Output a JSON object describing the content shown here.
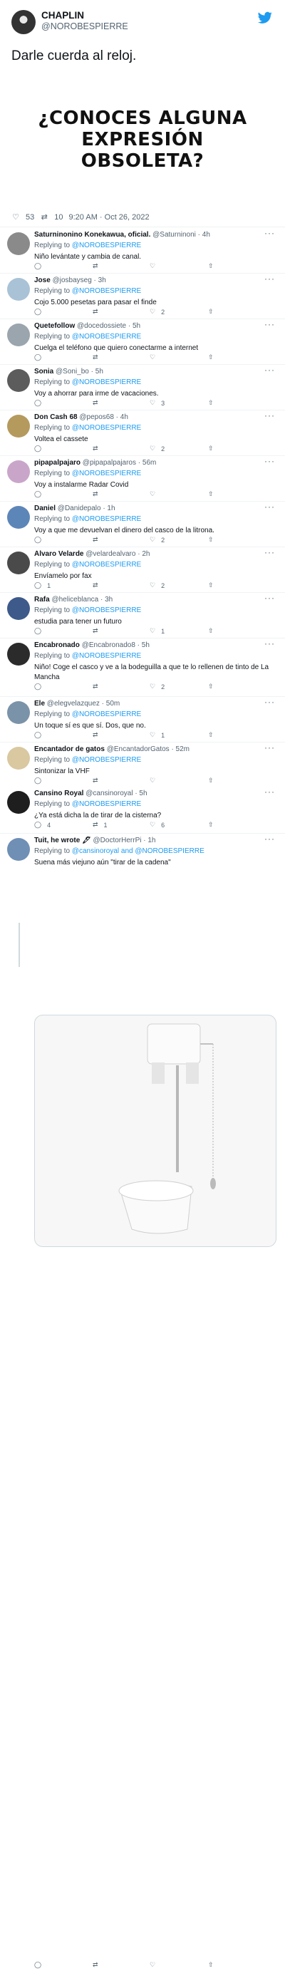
{
  "tweet": {
    "name": "CHAPLIN",
    "handle": "@NOROBESPIERRE",
    "text": "Darle cuerda al reloj.",
    "image_text": "¿CONOCES ALGUNA EXPRESIÓN OBSOLETA?",
    "likes": "53",
    "retweets": "10",
    "timestamp": "9:20 AM · Oct 26, 2022"
  },
  "replies": [
    {
      "name": "Saturninonino Konekawua, oficial.",
      "handle": "@Saturninoni · 4h",
      "replying": "Replying to",
      "to": "@NOROBESPIERRE",
      "text": "Niño levántate y cambia de canal.",
      "replies": "",
      "retweets": "",
      "likes": "",
      "avatar_color": "#8a8a8a"
    },
    {
      "name": "Jose",
      "handle": "@josbayseg · 3h",
      "replying": "Replying to",
      "to": "@NOROBESPIERRE",
      "text": "Cojo 5.000 pesetas para pasar el finde",
      "replies": "",
      "retweets": "",
      "likes": "2",
      "avatar_color": "#a9c2d6"
    },
    {
      "name": "Quetefollow",
      "handle": "@docedossiete · 5h",
      "replying": "Replying to",
      "to": "@NOROBESPIERRE",
      "text": "Cuelga el teléfono que quiero conectarme a internet",
      "replies": "",
      "retweets": "",
      "likes": "",
      "avatar_color": "#9aa5ae"
    },
    {
      "name": "Sonia",
      "handle": "@Soni_bo · 5h",
      "replying": "Replying to",
      "to": "@NOROBESPIERRE",
      "text": "Voy a ahorrar para irme de vacaciones.",
      "replies": "",
      "retweets": "",
      "likes": "3",
      "avatar_color": "#5c5c5c"
    },
    {
      "name": "Don Cash 68",
      "handle": "@pepos68 · 4h",
      "replying": "Replying to",
      "to": "@NOROBESPIERRE",
      "text": "Voltea el cassete",
      "replies": "",
      "retweets": "",
      "likes": "2",
      "avatar_color": "#b59a5e"
    },
    {
      "name": "pipapalpajaro",
      "handle": "@pipapalpajaros · 56m",
      "replying": "Replying to",
      "to": "@NOROBESPIERRE",
      "text": "Voy a instalarme Radar Covid",
      "replies": "",
      "retweets": "",
      "likes": "",
      "avatar_color": "#c9a6c9"
    },
    {
      "name": "Daniel",
      "handle": "@Danidepalo · 1h",
      "replying": "Replying to",
      "to": "@NOROBESPIERRE",
      "text": "Voy a que me devuelvan el dinero del casco de la litrona.",
      "replies": "",
      "retweets": "",
      "likes": "2",
      "avatar_color": "#5d86b8"
    },
    {
      "name": "Álvaro Velarde",
      "handle": "@velardealvaro · 2h",
      "replying": "Replying to",
      "to": "@NOROBESPIERRE",
      "text": "Envíamelo por fax",
      "replies": "1",
      "retweets": "",
      "likes": "2",
      "avatar_color": "#4a4a4a"
    },
    {
      "name": "Rafa",
      "handle": "@heliceblanca · 3h",
      "replying": "Replying to",
      "to": "@NOROBESPIERRE",
      "text": "estudia para tener un futuro",
      "replies": "",
      "retweets": "",
      "likes": "1",
      "avatar_color": "#3d5a8a"
    },
    {
      "name": "Encabronado",
      "handle": "@Encabronado8 · 5h",
      "replying": "Replying to",
      "to": "@NOROBESPIERRE",
      "text": "Niño! Coge el casco y ve a la bodeguilla a que te lo rellenen de tinto de La Mancha",
      "replies": "",
      "retweets": "",
      "likes": "2",
      "avatar_color": "#2b2b2b"
    },
    {
      "name": "Ele",
      "handle": "@elegvelazquez · 50m",
      "replying": "Replying to",
      "to": "@NOROBESPIERRE",
      "text": "Un toque sí es que sí. Dos, que no.",
      "replies": "",
      "retweets": "",
      "likes": "1",
      "avatar_color": "#7b93a8"
    },
    {
      "name": "Encantador de gatos",
      "handle": "@EncantadorGatos · 52m",
      "replying": "Replying to",
      "to": "@NOROBESPIERRE",
      "text": "Sintonizar la VHF",
      "replies": "",
      "retweets": "",
      "likes": "",
      "avatar_color": "#d9c8a0"
    },
    {
      "name": "Cansino Royal",
      "handle": "@cansinoroyal · 5h",
      "replying": "Replying to",
      "to": "@NOROBESPIERRE",
      "text": "¿Ya está dicha la de tirar de la cisterna?",
      "replies": "4",
      "retweets": "1",
      "likes": "6",
      "avatar_color": "#1e1e1e"
    },
    {
      "name": "Tuit, he wrote 🖋",
      "handle": "@DoctorHerrPi · 1h",
      "replying": "Replying to",
      "to": "@cansinoroyal and @NOROBESPIERRE",
      "text": "Suena más viejuno aún \"tirar de la cadena\"",
      "replies": "",
      "retweets": "",
      "likes": "",
      "avatar_color": "#6f8fb5"
    }
  ],
  "colors": {
    "accent": "#1d9bf0",
    "muted": "#536471"
  }
}
